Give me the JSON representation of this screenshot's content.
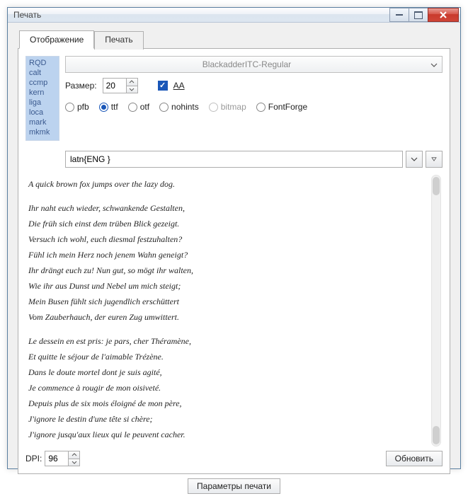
{
  "window": {
    "title": "Печать"
  },
  "tabs": {
    "display": "Отображение",
    "print": "Печать"
  },
  "features": [
    "RQD",
    "calt",
    "ccmp",
    "kern",
    "liga",
    "loca",
    "mark",
    "mkmk"
  ],
  "font": {
    "name": "BlackadderITC-Regular"
  },
  "size": {
    "label": "Размер:",
    "value": "20"
  },
  "aa": {
    "label": "AA",
    "checked": true
  },
  "formats": {
    "pfb": "pfb",
    "ttf": "ttf",
    "otf": "otf",
    "nohints": "nohints",
    "bitmap": "bitmap",
    "fontforge": "FontForge",
    "selected": "ttf"
  },
  "script": {
    "value": "latn{ENG }"
  },
  "preview": {
    "pangram": "A quick brown fox jumps over the lazy dog.",
    "german": [
      "Ihr naht euch wieder, schwankende Gestalten,",
      "Die früh sich einst dem trüben Blick gezeigt.",
      "Versuch ich wohl, euch diesmal festzuhalten?",
      "Fühl ich mein Herz noch jenem Wahn geneigt?",
      "Ihr drängt euch zu! Nun gut, so mögt ihr walten,",
      "Wie ihr aus Dunst und Nebel um mich steigt;",
      "Mein Busen fühlt sich jugendlich erschüttert",
      "Vom Zauberhauch, der euren Zug umwittert."
    ],
    "french": [
      "Le dessein en est pris: je pars, cher Théramène,",
      "Et quitte le séjour de l'aimable Trézène.",
      "Dans le doute mortel dont je suis agité,",
      "Je commence à rougir de mon oisiveté.",
      "Depuis plus de six mois éloigné de mon père,",
      "J'ignore le destin d'une tête si chère;",
      "J'ignore jusqu'aux lieux qui le peuvent cacher."
    ]
  },
  "dpi": {
    "label": "DPI:",
    "value": "96"
  },
  "buttons": {
    "refresh": "Обновить",
    "params": "Параметры печати"
  }
}
